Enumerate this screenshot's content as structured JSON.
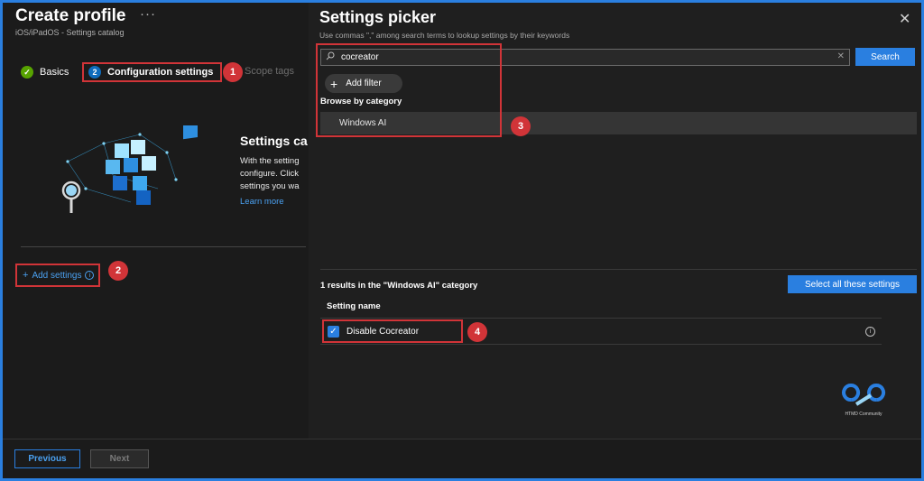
{
  "page": {
    "title": "Create profile",
    "more": "···",
    "subtitle": "iOS/iPadOS - Settings catalog"
  },
  "steps": [
    {
      "label": "Basics",
      "status": "done",
      "icon": "check-icon"
    },
    {
      "label": "Configuration settings",
      "status": "current",
      "number": "2"
    },
    {
      "label": "Scope tags",
      "status": "upcoming"
    }
  ],
  "settings_catalog": {
    "title": "Settings ca",
    "desc_lines": [
      "With the setting",
      "configure. Click",
      "settings you wa"
    ],
    "learn_more": "Learn more"
  },
  "add_settings": {
    "plus": "+",
    "label": "Add settings",
    "info": "i"
  },
  "footer": {
    "previous": "Previous",
    "next": "Next"
  },
  "picker": {
    "title": "Settings picker",
    "close": "✕",
    "subtitle": "Use commas \",\" among search terms to lookup settings by their keywords",
    "search_value": "cocreator",
    "search_button": "Search",
    "clear": "✕",
    "add_filter": "Add filter",
    "add_filter_plus": "+",
    "browse_label": "Browse by category",
    "category": "Windows AI",
    "results_label": "1 results in the \"Windows AI\" category",
    "select_all": "Select all these settings",
    "column_header": "Setting name",
    "setting": {
      "name": "Disable Cocreator",
      "checked": true
    },
    "info": "i"
  },
  "callouts": [
    "1",
    "2",
    "3",
    "4"
  ],
  "watermark": {
    "text": "HTMD Community"
  },
  "colors": {
    "accent": "#2a7fe0",
    "callout": "#d13438",
    "success": "#57a300"
  }
}
